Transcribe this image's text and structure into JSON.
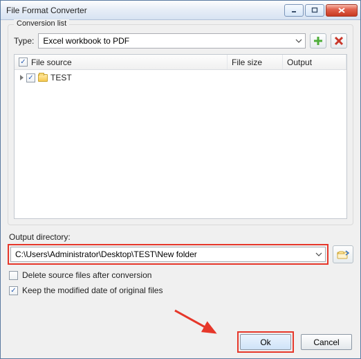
{
  "window": {
    "title": "File Format Converter"
  },
  "group": {
    "label": "Conversion list"
  },
  "type": {
    "label": "Type:",
    "value": "Excel workbook to PDF"
  },
  "list": {
    "headers": {
      "source": "File source",
      "size": "File size",
      "output": "Output"
    },
    "root": {
      "name": "TEST"
    }
  },
  "output": {
    "label": "Output directory:",
    "path": "C:\\Users\\Administrator\\Desktop\\TEST\\New folder"
  },
  "options": {
    "delete": {
      "checked": false,
      "label": "Delete source files after conversion"
    },
    "keepdate": {
      "checked": true,
      "label": "Keep the modified date of original files"
    }
  },
  "buttons": {
    "ok": "Ok",
    "cancel": "Cancel"
  }
}
